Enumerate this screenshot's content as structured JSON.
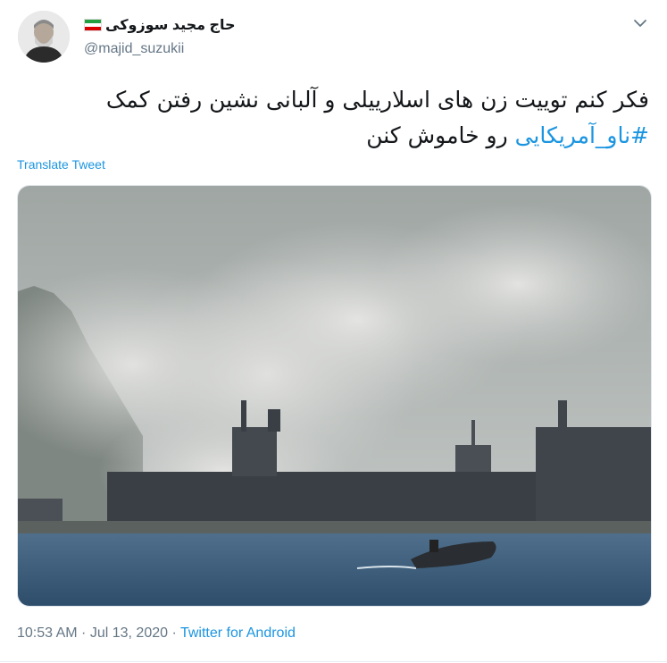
{
  "user": {
    "display_name": "حاج مجید سوزوکی",
    "handle": "@majid_suzukii",
    "flag_icon": "iran-flag-icon",
    "flag_colors": [
      "#239f40",
      "#ffffff",
      "#da0000"
    ]
  },
  "menu": {
    "icon": "chevron-down-icon"
  },
  "tweet": {
    "text": "فکر کنم توییت زن های اسلارییلی و آلبانی نشین رفتن کمک ",
    "hashtag": "#ناو_آمریکایی",
    "text_after": " رو خاموش کنن"
  },
  "translate_label": "Translate Tweet",
  "meta": {
    "time": "10:53 AM",
    "separator": " · ",
    "date": "Jul 13, 2020",
    "separator2": " · ",
    "source": "Twitter for Android"
  },
  "colors": {
    "link": "#1b95e0",
    "muted": "#657786",
    "text": "#14171a"
  }
}
